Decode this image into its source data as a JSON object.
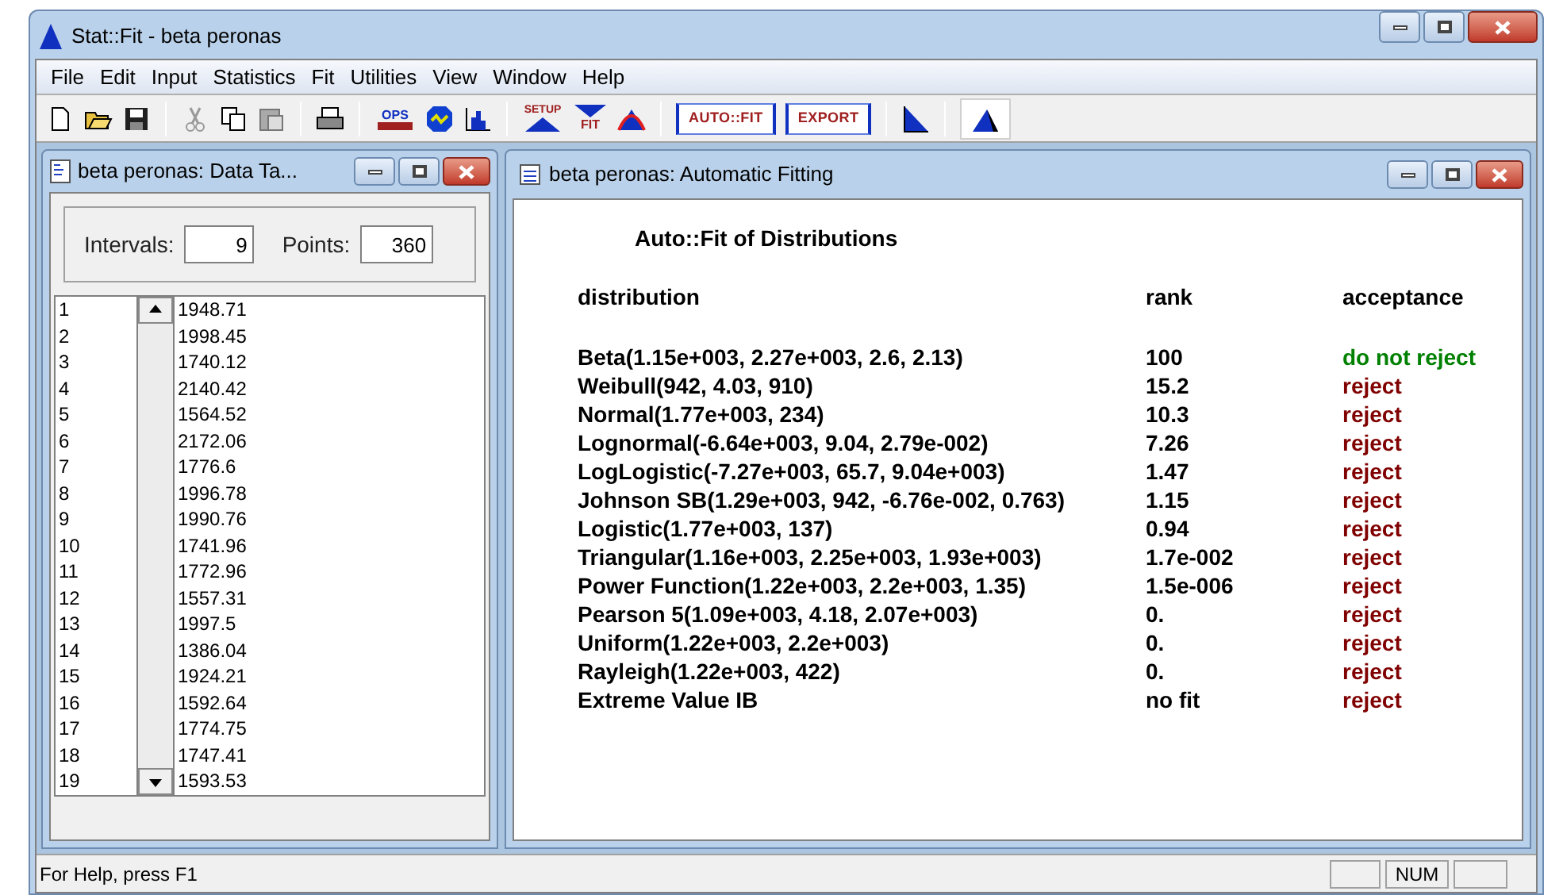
{
  "window": {
    "title": "Stat::Fit - beta peronas"
  },
  "menu": [
    "File",
    "Edit",
    "Input",
    "Statistics",
    "Fit",
    "Utilities",
    "View",
    "Window",
    "Help"
  ],
  "toolbar": {
    "labels": [
      "OPS",
      "SETUP",
      "FIT",
      "AUTO::FIT",
      "EXPORT"
    ]
  },
  "data_window": {
    "title": "beta peronas: Data Ta...",
    "intervals_label": "Intervals:",
    "intervals": "9",
    "points_label": "Points:",
    "points": "360",
    "rows": [
      {
        "index": "1",
        "value": "1948.71"
      },
      {
        "index": "2",
        "value": "1998.45"
      },
      {
        "index": "3",
        "value": "1740.12"
      },
      {
        "index": "4",
        "value": "2140.42"
      },
      {
        "index": "5",
        "value": "1564.52"
      },
      {
        "index": "6",
        "value": "2172.06"
      },
      {
        "index": "7",
        "value": "1776.6"
      },
      {
        "index": "8",
        "value": "1996.78"
      },
      {
        "index": "9",
        "value": "1990.76"
      },
      {
        "index": "10",
        "value": "1741.96"
      },
      {
        "index": "11",
        "value": "1772.96"
      },
      {
        "index": "12",
        "value": "1557.31"
      },
      {
        "index": "13",
        "value": "1997.5"
      },
      {
        "index": "14",
        "value": "1386.04"
      },
      {
        "index": "15",
        "value": "1924.21"
      },
      {
        "index": "16",
        "value": "1592.64"
      },
      {
        "index": "17",
        "value": "1774.75"
      },
      {
        "index": "18",
        "value": "1747.41"
      },
      {
        "index": "19",
        "value": "1593.53"
      }
    ]
  },
  "fit_window": {
    "title": "beta peronas: Automatic Fitting",
    "heading": "Auto::Fit of Distributions",
    "columns": [
      "distribution",
      "rank",
      "acceptance"
    ],
    "rows": [
      {
        "distribution": "Beta(1.15e+003, 2.27e+003, 2.6, 2.13)",
        "rank": "100",
        "acceptance": "do not reject",
        "color": "#008000"
      },
      {
        "distribution": "Weibull(942, 4.03, 910)",
        "rank": "15.2",
        "acceptance": "reject",
        "color": "#800000"
      },
      {
        "distribution": "Normal(1.77e+003, 234)",
        "rank": "10.3",
        "acceptance": "reject",
        "color": "#800000"
      },
      {
        "distribution": "Lognormal(-6.64e+003, 9.04, 2.79e-002)",
        "rank": "7.26",
        "acceptance": "reject",
        "color": "#800000"
      },
      {
        "distribution": "LogLogistic(-7.27e+003, 65.7, 9.04e+003)",
        "rank": "1.47",
        "acceptance": "reject",
        "color": "#800000"
      },
      {
        "distribution": "Johnson SB(1.29e+003, 942, -6.76e-002, 0.763)",
        "rank": "1.15",
        "acceptance": "reject",
        "color": "#800000"
      },
      {
        "distribution": "Logistic(1.77e+003, 137)",
        "rank": "0.94",
        "acceptance": "reject",
        "color": "#800000"
      },
      {
        "distribution": "Triangular(1.16e+003, 2.25e+003, 1.93e+003)",
        "rank": "1.7e-002",
        "acceptance": "reject",
        "color": "#800000"
      },
      {
        "distribution": "Power Function(1.22e+003, 2.2e+003, 1.35)",
        "rank": "1.5e-006",
        "acceptance": "reject",
        "color": "#800000"
      },
      {
        "distribution": "Pearson 5(1.09e+003, 4.18, 2.07e+003)",
        "rank": "0.",
        "acceptance": "reject",
        "color": "#800000"
      },
      {
        "distribution": "Uniform(1.22e+003, 2.2e+003)",
        "rank": "0.",
        "acceptance": "reject",
        "color": "#800000"
      },
      {
        "distribution": "Rayleigh(1.22e+003, 422)",
        "rank": "0.",
        "acceptance": "reject",
        "color": "#800000"
      },
      {
        "distribution": "Extreme Value IB",
        "rank": "no fit",
        "acceptance": "reject",
        "color": "#800000"
      }
    ]
  },
  "status_bar": {
    "text": "For Help, press F1",
    "indicator": "NUM"
  }
}
